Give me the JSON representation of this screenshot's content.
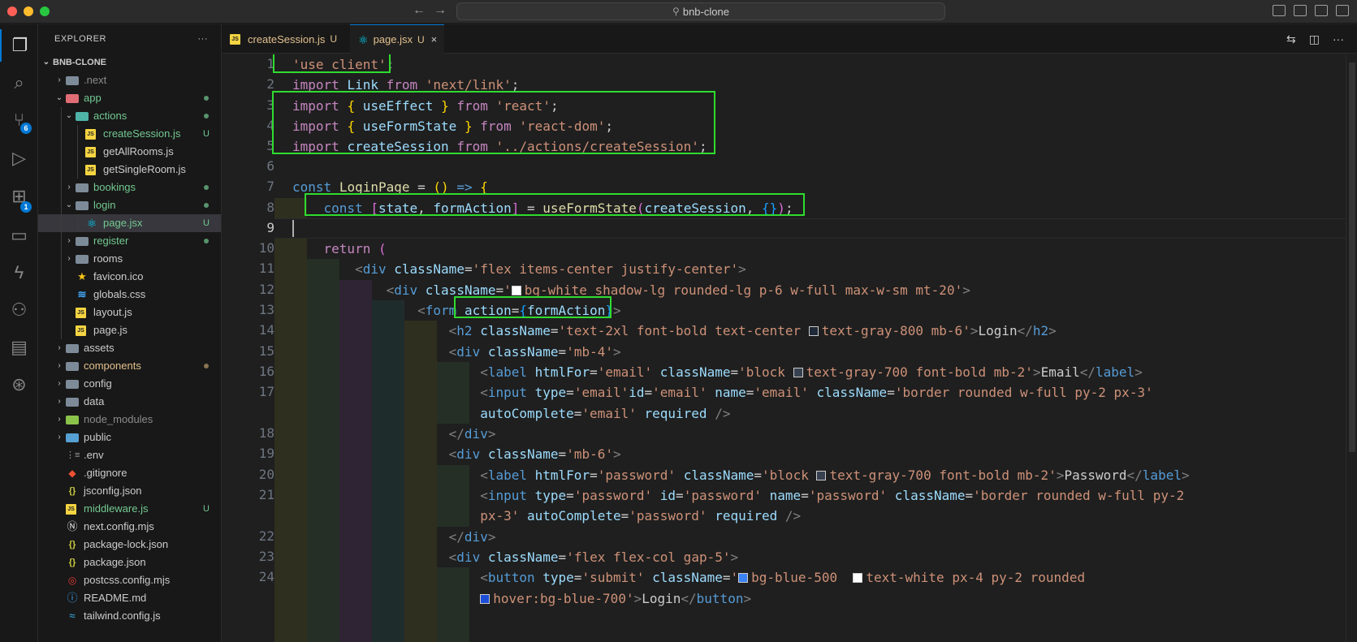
{
  "window": {
    "search_text": "bnb-clone"
  },
  "activity_bar": {
    "scm_badge": "6",
    "extensions_badge": "1"
  },
  "explorer": {
    "title": "EXPLORER",
    "more": "···",
    "root": "BNB-CLONE",
    "items": [
      {
        "label": ".next",
        "depth": 1,
        "kind": "folder-next",
        "chevron": "›",
        "status": ""
      },
      {
        "label": "app",
        "depth": 1,
        "kind": "folder-red",
        "chevron": "⌄",
        "status": "dot"
      },
      {
        "label": "actions",
        "depth": 2,
        "kind": "folder-teal",
        "chevron": "⌄",
        "status": "dot"
      },
      {
        "label": "createSession.js",
        "depth": 3,
        "kind": "js",
        "chevron": "",
        "status": "U"
      },
      {
        "label": "getAllRooms.js",
        "depth": 3,
        "kind": "js",
        "chevron": "",
        "status": ""
      },
      {
        "label": "getSingleRoom.js",
        "depth": 3,
        "kind": "js",
        "chevron": "",
        "status": ""
      },
      {
        "label": "bookings",
        "depth": 2,
        "kind": "folder",
        "chevron": "›",
        "status": "dot"
      },
      {
        "label": "login",
        "depth": 2,
        "kind": "folder",
        "chevron": "⌄",
        "status": "dot"
      },
      {
        "label": "page.jsx",
        "depth": 3,
        "kind": "react",
        "chevron": "",
        "status": "U"
      },
      {
        "label": "register",
        "depth": 2,
        "kind": "folder",
        "chevron": "›",
        "status": "dot"
      },
      {
        "label": "rooms",
        "depth": 2,
        "kind": "folder",
        "chevron": "›",
        "status": ""
      },
      {
        "label": "favicon.ico",
        "depth": 2,
        "kind": "star",
        "chevron": "",
        "status": ""
      },
      {
        "label": "globals.css",
        "depth": 2,
        "kind": "css",
        "chevron": "",
        "status": ""
      },
      {
        "label": "layout.js",
        "depth": 2,
        "kind": "js",
        "chevron": "",
        "status": ""
      },
      {
        "label": "page.js",
        "depth": 2,
        "kind": "js",
        "chevron": "",
        "status": ""
      },
      {
        "label": "assets",
        "depth": 1,
        "kind": "folder",
        "chevron": "›",
        "status": ""
      },
      {
        "label": "components",
        "depth": 1,
        "kind": "folder",
        "chevron": "›",
        "status": "dot-brown"
      },
      {
        "label": "config",
        "depth": 1,
        "kind": "folder",
        "chevron": "›",
        "status": ""
      },
      {
        "label": "data",
        "depth": 1,
        "kind": "folder",
        "chevron": "›",
        "status": ""
      },
      {
        "label": "node_modules",
        "depth": 1,
        "kind": "folder-green",
        "chevron": "›",
        "status": ""
      },
      {
        "label": "public",
        "depth": 1,
        "kind": "folder-blue",
        "chevron": "›",
        "status": ""
      },
      {
        "label": ".env",
        "depth": 1,
        "kind": "env",
        "chevron": "",
        "status": ""
      },
      {
        "label": ".gitignore",
        "depth": 1,
        "kind": "git",
        "chevron": "",
        "status": ""
      },
      {
        "label": "jsconfig.json",
        "depth": 1,
        "kind": "json",
        "chevron": "",
        "status": ""
      },
      {
        "label": "middleware.js",
        "depth": 1,
        "kind": "js",
        "chevron": "",
        "status": "U"
      },
      {
        "label": "next.config.mjs",
        "depth": 1,
        "kind": "next",
        "chevron": "",
        "status": ""
      },
      {
        "label": "package-lock.json",
        "depth": 1,
        "kind": "json",
        "chevron": "",
        "status": ""
      },
      {
        "label": "package.json",
        "depth": 1,
        "kind": "json",
        "chevron": "",
        "status": ""
      },
      {
        "label": "postcss.config.mjs",
        "depth": 1,
        "kind": "post",
        "chevron": "",
        "status": ""
      },
      {
        "label": "README.md",
        "depth": 1,
        "kind": "info",
        "chevron": "",
        "status": ""
      },
      {
        "label": "tailwind.config.js",
        "depth": 1,
        "kind": "tw",
        "chevron": "",
        "status": ""
      }
    ]
  },
  "tabs": [
    {
      "label": "createSession.js",
      "status": "U",
      "active": false
    },
    {
      "label": "page.jsx",
      "status": "U",
      "active": true,
      "close": "×"
    }
  ],
  "editor": {
    "line_numbers": [
      "1",
      "2",
      "3",
      "4",
      "5",
      "6",
      "7",
      "8",
      "9",
      "10",
      "11",
      "12",
      "13",
      "14",
      "15",
      "16",
      "17",
      "",
      "18",
      "19",
      "20",
      "21",
      "",
      "22",
      "23",
      "24",
      ""
    ],
    "current_line": "9"
  },
  "colors": {
    "accent": "#0078d4",
    "highlight_box": "#2fdc2f",
    "git_untracked": "#73c991",
    "modified": "#e2c08d"
  }
}
